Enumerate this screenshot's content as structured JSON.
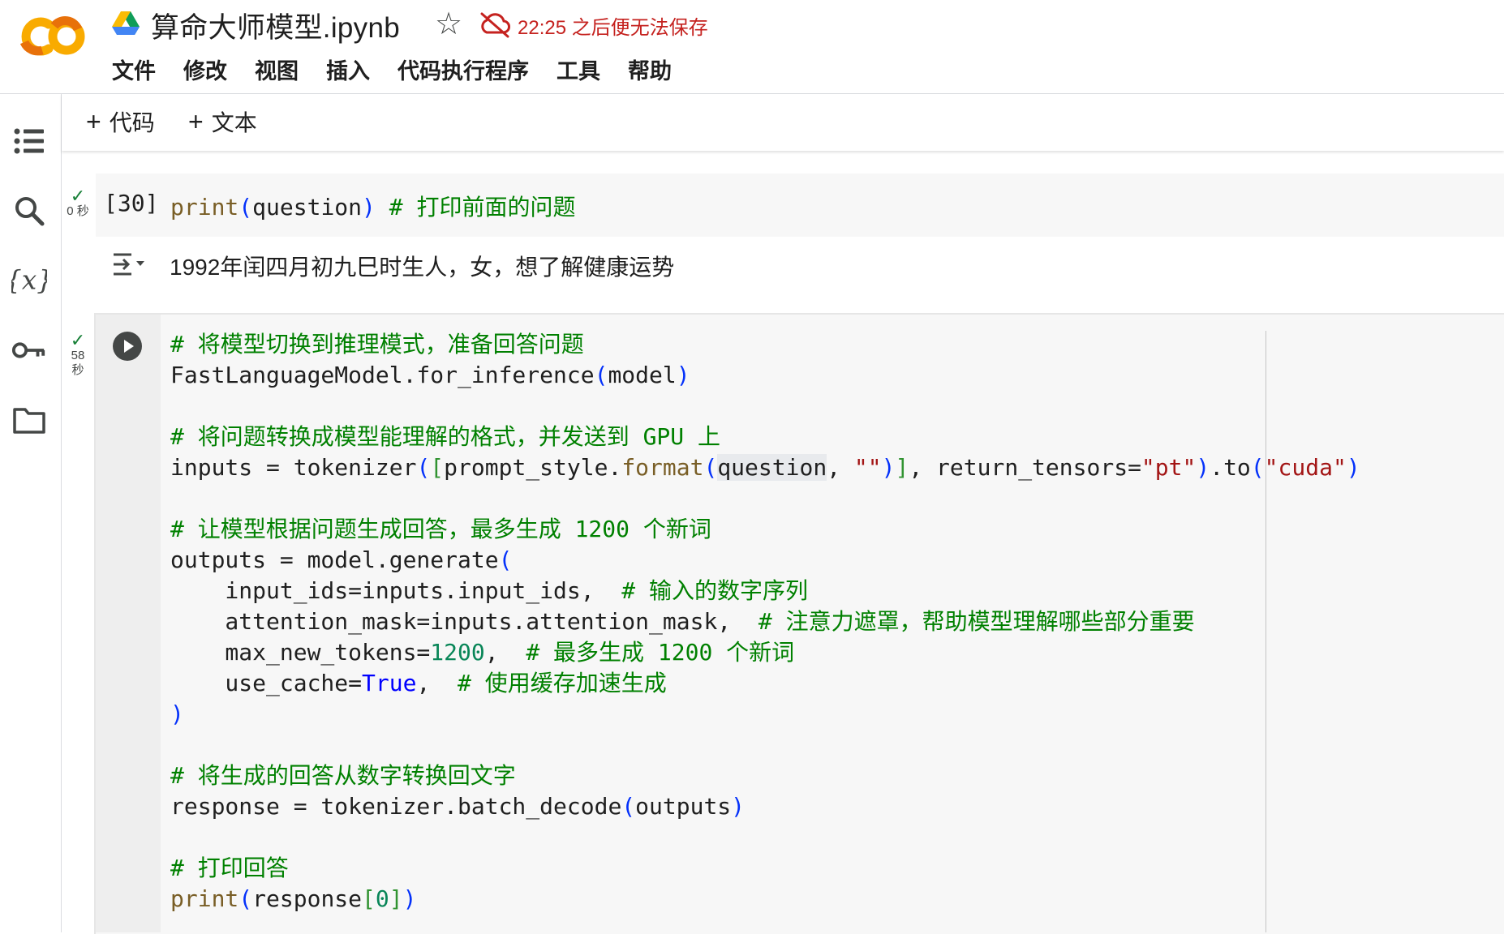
{
  "header": {
    "title": "算命大师模型.ipynb",
    "save_warning": "22:25 之后便无法保存",
    "menu": [
      "文件",
      "修改",
      "视图",
      "插入",
      "代码执行程序",
      "工具",
      "帮助"
    ]
  },
  "toolbar": {
    "add_code": "代码",
    "add_text": "文本"
  },
  "cells": [
    {
      "execution_count": "[30]",
      "status_check": "✓",
      "run_time": "0 秒",
      "code": "print(question) # 打印前面的问题",
      "output": "1992年闰四月初九巳时生人，女，想了解健康运势"
    },
    {
      "status_check": "✓",
      "run_time_value": "58",
      "run_time_unit": "秒",
      "lines": [
        "# 将模型切换到推理模式，准备回答问题",
        "FastLanguageModel.for_inference(model)",
        "",
        "# 将问题转换成模型能理解的格式，并发送到 GPU 上",
        "inputs = tokenizer([prompt_style.format(question, \"\")], return_tensors=\"pt\").to(\"cuda\")",
        "",
        "# 让模型根据问题生成回答，最多生成 1200 个新词",
        "outputs = model.generate(",
        "    input_ids=inputs.input_ids,  # 输入的数字序列",
        "    attention_mask=inputs.attention_mask,  # 注意力遮罩，帮助模型理解哪些部分重要",
        "    max_new_tokens=1200,  # 最多生成 1200 个新词",
        "    use_cache=True,  # 使用缓存加速生成",
        ")",
        "",
        "# 将生成的回答从数字转换回文字",
        "response = tokenizer.batch_decode(outputs)",
        "",
        "# 打印回答",
        "print(response[0])"
      ]
    }
  ],
  "icons": {
    "logo": "colab-logo",
    "drive": "google-drive-icon",
    "star": "star-icon",
    "cloud": "cloud-off-icon",
    "rail": [
      "table-of-contents-icon",
      "search-icon",
      "variables-icon",
      "secrets-key-icon",
      "files-folder-icon"
    ],
    "output": "output-actions-icon",
    "run": "run-cell-icon"
  },
  "colors": {
    "accent_orange": "#f9ab00",
    "accent_dark_orange": "#e8710a",
    "warning_red": "#c5221f",
    "success_green": "#188038",
    "comment_green": "#008000",
    "function_brown": "#795e26",
    "string_red": "#a31515",
    "number_green": "#098658",
    "keyword_blue": "#0000ff"
  }
}
